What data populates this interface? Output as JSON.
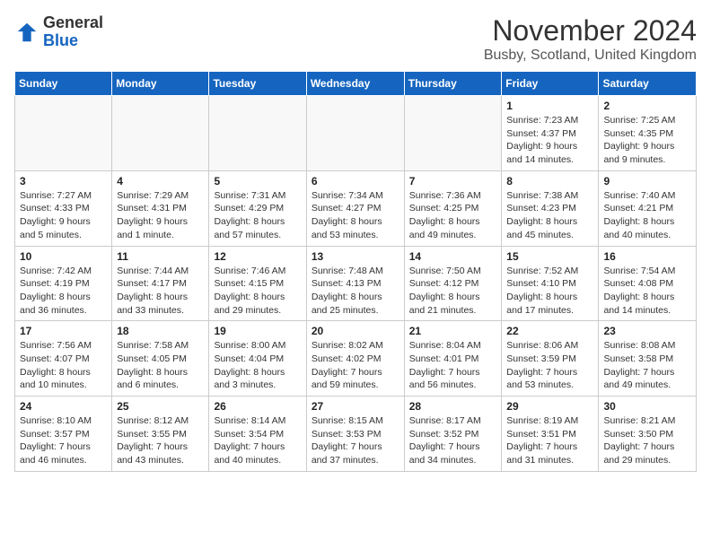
{
  "header": {
    "logo_general": "General",
    "logo_blue": "Blue",
    "month": "November 2024",
    "location": "Busby, Scotland, United Kingdom"
  },
  "days_of_week": [
    "Sunday",
    "Monday",
    "Tuesday",
    "Wednesday",
    "Thursday",
    "Friday",
    "Saturday"
  ],
  "weeks": [
    [
      {
        "day": "",
        "info": ""
      },
      {
        "day": "",
        "info": ""
      },
      {
        "day": "",
        "info": ""
      },
      {
        "day": "",
        "info": ""
      },
      {
        "day": "",
        "info": ""
      },
      {
        "day": "1",
        "info": "Sunrise: 7:23 AM\nSunset: 4:37 PM\nDaylight: 9 hours and 14 minutes."
      },
      {
        "day": "2",
        "info": "Sunrise: 7:25 AM\nSunset: 4:35 PM\nDaylight: 9 hours and 9 minutes."
      }
    ],
    [
      {
        "day": "3",
        "info": "Sunrise: 7:27 AM\nSunset: 4:33 PM\nDaylight: 9 hours and 5 minutes."
      },
      {
        "day": "4",
        "info": "Sunrise: 7:29 AM\nSunset: 4:31 PM\nDaylight: 9 hours and 1 minute."
      },
      {
        "day": "5",
        "info": "Sunrise: 7:31 AM\nSunset: 4:29 PM\nDaylight: 8 hours and 57 minutes."
      },
      {
        "day": "6",
        "info": "Sunrise: 7:34 AM\nSunset: 4:27 PM\nDaylight: 8 hours and 53 minutes."
      },
      {
        "day": "7",
        "info": "Sunrise: 7:36 AM\nSunset: 4:25 PM\nDaylight: 8 hours and 49 minutes."
      },
      {
        "day": "8",
        "info": "Sunrise: 7:38 AM\nSunset: 4:23 PM\nDaylight: 8 hours and 45 minutes."
      },
      {
        "day": "9",
        "info": "Sunrise: 7:40 AM\nSunset: 4:21 PM\nDaylight: 8 hours and 40 minutes."
      }
    ],
    [
      {
        "day": "10",
        "info": "Sunrise: 7:42 AM\nSunset: 4:19 PM\nDaylight: 8 hours and 36 minutes."
      },
      {
        "day": "11",
        "info": "Sunrise: 7:44 AM\nSunset: 4:17 PM\nDaylight: 8 hours and 33 minutes."
      },
      {
        "day": "12",
        "info": "Sunrise: 7:46 AM\nSunset: 4:15 PM\nDaylight: 8 hours and 29 minutes."
      },
      {
        "day": "13",
        "info": "Sunrise: 7:48 AM\nSunset: 4:13 PM\nDaylight: 8 hours and 25 minutes."
      },
      {
        "day": "14",
        "info": "Sunrise: 7:50 AM\nSunset: 4:12 PM\nDaylight: 8 hours and 21 minutes."
      },
      {
        "day": "15",
        "info": "Sunrise: 7:52 AM\nSunset: 4:10 PM\nDaylight: 8 hours and 17 minutes."
      },
      {
        "day": "16",
        "info": "Sunrise: 7:54 AM\nSunset: 4:08 PM\nDaylight: 8 hours and 14 minutes."
      }
    ],
    [
      {
        "day": "17",
        "info": "Sunrise: 7:56 AM\nSunset: 4:07 PM\nDaylight: 8 hours and 10 minutes."
      },
      {
        "day": "18",
        "info": "Sunrise: 7:58 AM\nSunset: 4:05 PM\nDaylight: 8 hours and 6 minutes."
      },
      {
        "day": "19",
        "info": "Sunrise: 8:00 AM\nSunset: 4:04 PM\nDaylight: 8 hours and 3 minutes."
      },
      {
        "day": "20",
        "info": "Sunrise: 8:02 AM\nSunset: 4:02 PM\nDaylight: 7 hours and 59 minutes."
      },
      {
        "day": "21",
        "info": "Sunrise: 8:04 AM\nSunset: 4:01 PM\nDaylight: 7 hours and 56 minutes."
      },
      {
        "day": "22",
        "info": "Sunrise: 8:06 AM\nSunset: 3:59 PM\nDaylight: 7 hours and 53 minutes."
      },
      {
        "day": "23",
        "info": "Sunrise: 8:08 AM\nSunset: 3:58 PM\nDaylight: 7 hours and 49 minutes."
      }
    ],
    [
      {
        "day": "24",
        "info": "Sunrise: 8:10 AM\nSunset: 3:57 PM\nDaylight: 7 hours and 46 minutes."
      },
      {
        "day": "25",
        "info": "Sunrise: 8:12 AM\nSunset: 3:55 PM\nDaylight: 7 hours and 43 minutes."
      },
      {
        "day": "26",
        "info": "Sunrise: 8:14 AM\nSunset: 3:54 PM\nDaylight: 7 hours and 40 minutes."
      },
      {
        "day": "27",
        "info": "Sunrise: 8:15 AM\nSunset: 3:53 PM\nDaylight: 7 hours and 37 minutes."
      },
      {
        "day": "28",
        "info": "Sunrise: 8:17 AM\nSunset: 3:52 PM\nDaylight: 7 hours and 34 minutes."
      },
      {
        "day": "29",
        "info": "Sunrise: 8:19 AM\nSunset: 3:51 PM\nDaylight: 7 hours and 31 minutes."
      },
      {
        "day": "30",
        "info": "Sunrise: 8:21 AM\nSunset: 3:50 PM\nDaylight: 7 hours and 29 minutes."
      }
    ]
  ]
}
